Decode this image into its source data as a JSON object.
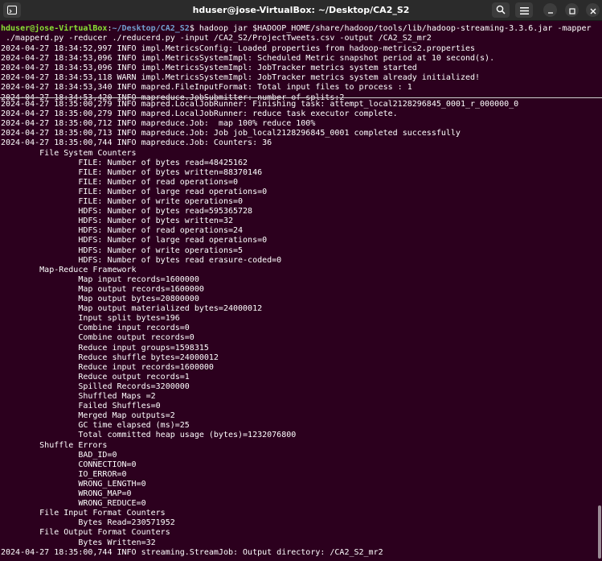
{
  "window": {
    "title": "hduser@jose-VirtualBox: ~/Desktop/CA2_S2"
  },
  "icons": {
    "new_tab": "terminal-tab-icon",
    "search": "search-icon",
    "menu": "hamburger-menu-icon",
    "minimize": "minimize-icon",
    "maximize": "maximize-icon",
    "close": "close-icon"
  },
  "colors": {
    "terminal_bg": "#2c001e",
    "prompt_user": "#8ae234",
    "prompt_path": "#729fcf"
  },
  "prompt": {
    "user": "hduser@jose-VirtualBox",
    "path": "~/Desktop/CA2_S2",
    "command_1": "$ hadoop jar $HADOOP_HOME/share/hadoop/tools/lib/hadoop-streaming-3.3.6.jar -mapper",
    "command_2": " ./mapperd.py -reducer ./reducerd.py -input /CA2_S2/ProjectTweets.csv -output /CA2_S2_mr2"
  },
  "top_log": [
    "2024-04-27 18:34:52,997 INFO impl.MetricsConfig: Loaded properties from hadoop-metrics2.properties",
    "2024-04-27 18:34:53,096 INFO impl.MetricsSystemImpl: Scheduled Metric snapshot period at 10 second(s).",
    "2024-04-27 18:34:53,096 INFO impl.MetricsSystemImpl: JobTracker metrics system started",
    "2024-04-27 18:34:53,118 WARN impl.MetricsSystemImpl: JobTracker metrics system already initialized!",
    "2024-04-27 18:34:53,340 INFO mapred.FileInputFormat: Total input files to process : 1",
    "2024-04-27 18:34:53,420 INFO mapreduce.JobSubmitter: number of splits:2"
  ],
  "bottom_log": [
    "2024-04-27 18:35:00,279 INFO mapred.LocalJobRunner: Finishing task: attempt_local2128296845_0001_r_000000_0",
    "2024-04-27 18:35:00,279 INFO mapred.LocalJobRunner: reduce task executor complete.",
    "2024-04-27 18:35:00,712 INFO mapreduce.Job:  map 100% reduce 100%",
    "2024-04-27 18:35:00,713 INFO mapreduce.Job: Job job_local2128296845_0001 completed successfully",
    "2024-04-27 18:35:00,744 INFO mapreduce.Job: Counters: 36",
    "        File System Counters",
    "                FILE: Number of bytes read=48425162",
    "                FILE: Number of bytes written=88370146",
    "                FILE: Number of read operations=0",
    "                FILE: Number of large read operations=0",
    "                FILE: Number of write operations=0",
    "                HDFS: Number of bytes read=595365728",
    "                HDFS: Number of bytes written=32",
    "                HDFS: Number of read operations=24",
    "                HDFS: Number of large read operations=0",
    "                HDFS: Number of write operations=5",
    "                HDFS: Number of bytes read erasure-coded=0",
    "        Map-Reduce Framework",
    "                Map input records=1600000",
    "                Map output records=1600000",
    "                Map output bytes=20800000",
    "                Map output materialized bytes=24000012",
    "                Input split bytes=196",
    "                Combine input records=0",
    "                Combine output records=0",
    "                Reduce input groups=1598315",
    "                Reduce shuffle bytes=24000012",
    "                Reduce input records=1600000",
    "                Reduce output records=1",
    "                Spilled Records=3200000",
    "                Shuffled Maps =2",
    "                Failed Shuffles=0",
    "                Merged Map outputs=2",
    "                GC time elapsed (ms)=25",
    "                Total committed heap usage (bytes)=1232076800",
    "        Shuffle Errors",
    "                BAD_ID=0",
    "                CONNECTION=0",
    "                IO_ERROR=0",
    "                WRONG_LENGTH=0",
    "                WRONG_MAP=0",
    "                WRONG_REDUCE=0",
    "        File Input Format Counters",
    "                Bytes Read=230571952",
    "        File Output Format Counters",
    "                Bytes Written=32",
    "2024-04-27 18:35:00,744 INFO streaming.StreamJob: Output directory: /CA2_S2_mr2"
  ]
}
